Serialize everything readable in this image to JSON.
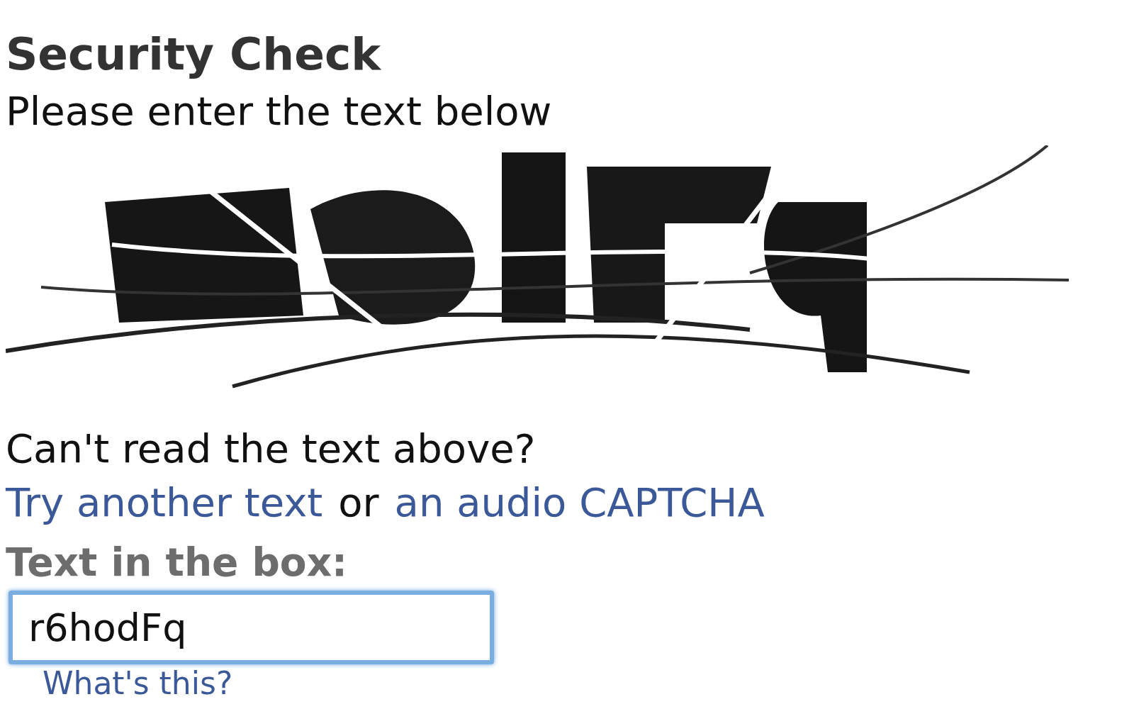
{
  "title": "Security Check",
  "instruction": "Please enter the text below",
  "help_question": "Can't read the text above?",
  "help_links": [
    {
      "kind": "link",
      "text": "Try another text"
    },
    {
      "kind": "text",
      "text": "or"
    },
    {
      "kind": "link",
      "text": "an audio CAPTCHA"
    }
  ],
  "field": {
    "label": "Text in the box:",
    "value": "r6hodFq",
    "focused": true
  },
  "whats_this": "What's this?"
}
